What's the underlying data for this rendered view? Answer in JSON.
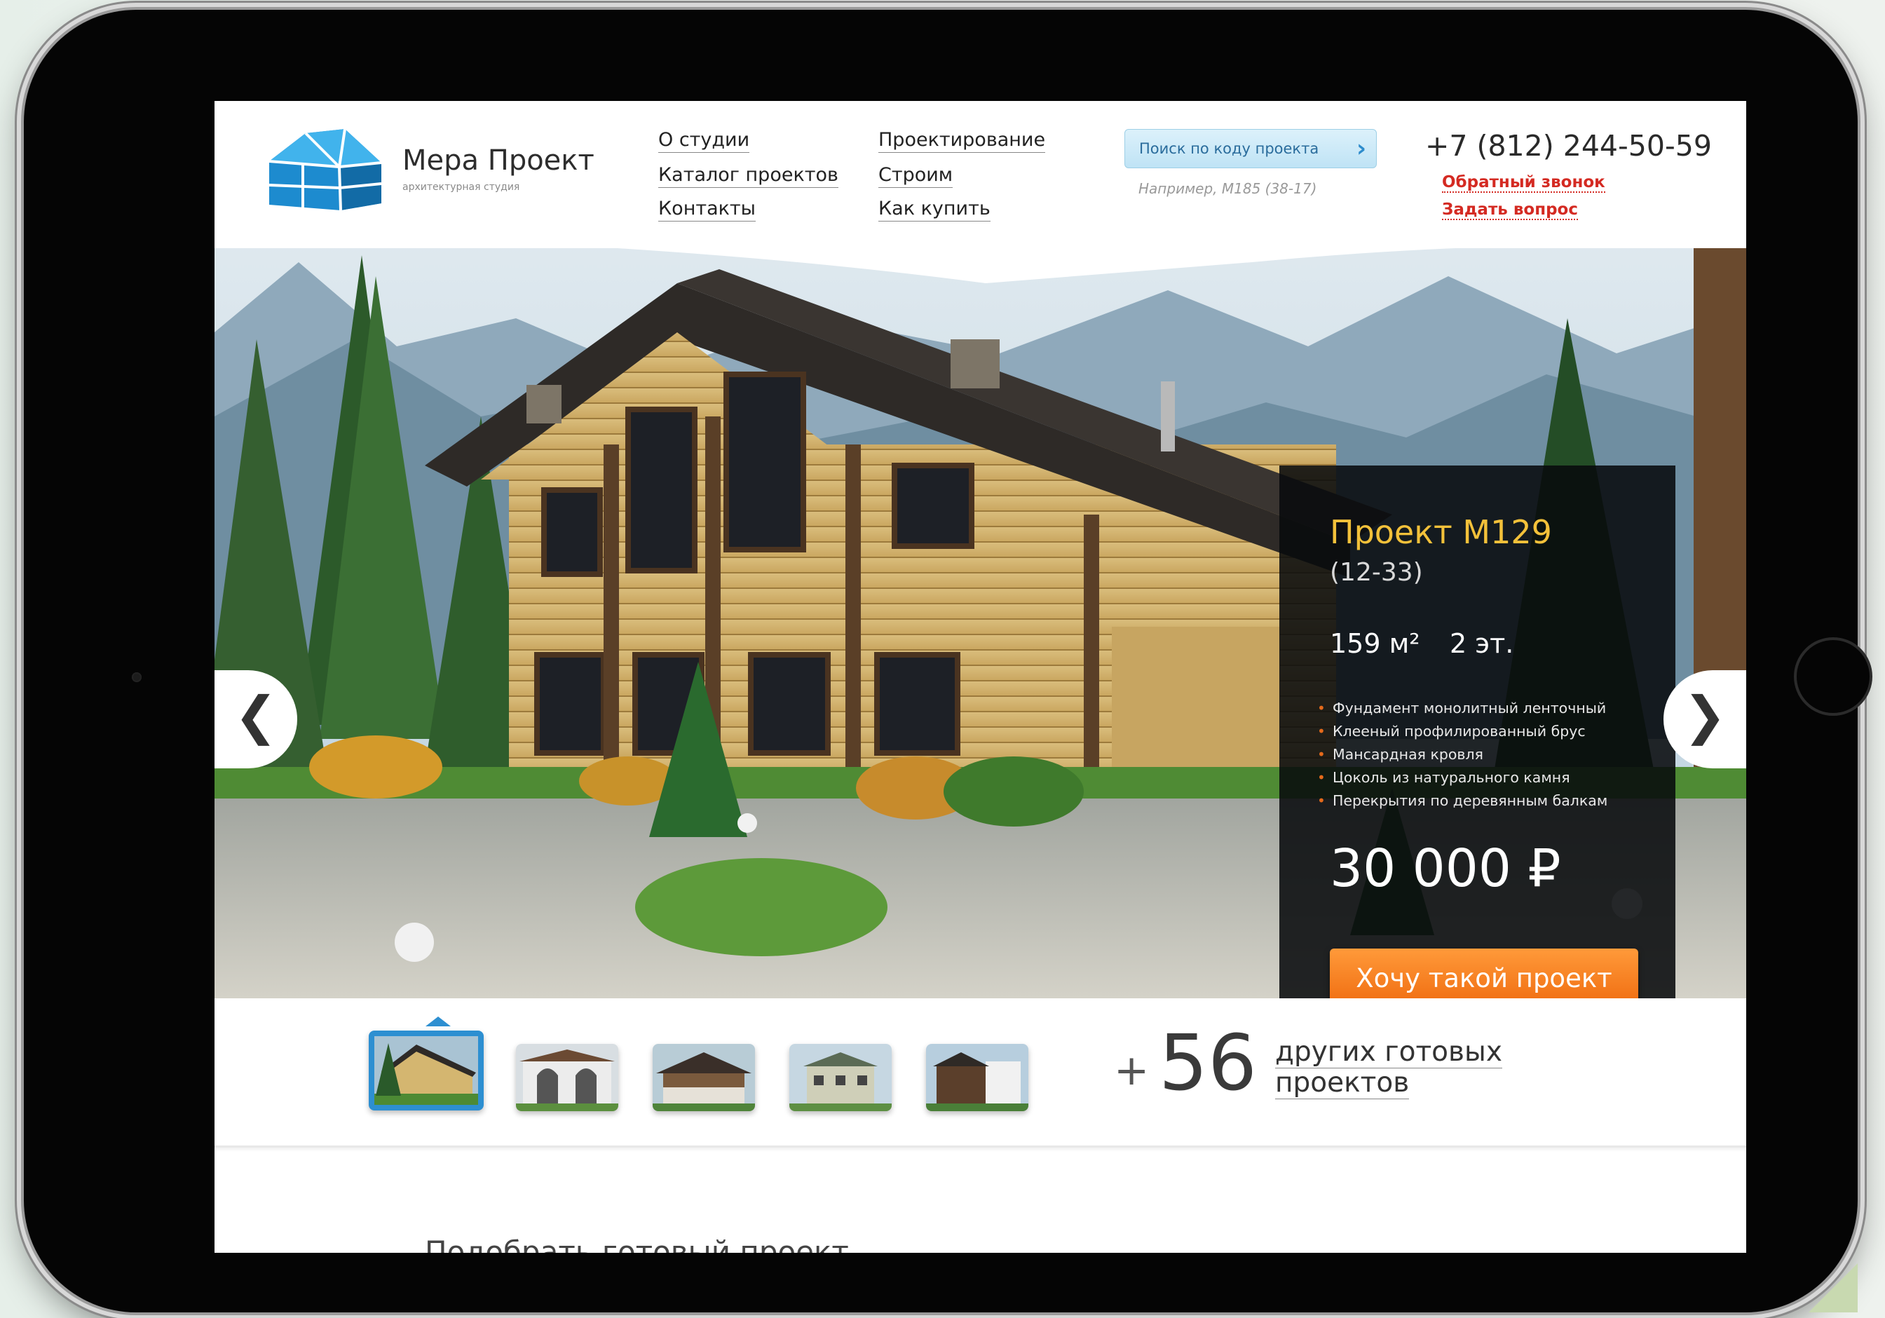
{
  "logo": {
    "title": "Мера Проект",
    "subtitle": "архитектурная студия"
  },
  "nav": {
    "col1": [
      "О студии",
      "Каталог проектов",
      "Контакты"
    ],
    "col2": [
      "Проектирование",
      "Строим",
      "Как купить"
    ]
  },
  "search": {
    "button_label": "Поиск по коду проекта",
    "hint": "Например, М185 (38-17)"
  },
  "contact": {
    "phone": "+7 (812) 244-50-59",
    "callback": "Обратный звонок",
    "ask": "Задать вопрос"
  },
  "project": {
    "title": "Проект М129",
    "code": "(12-33)",
    "area": "159 м²",
    "floors": "2 эт.",
    "features": [
      "Фундамент монолитный ленточный",
      "Клееный профилированный брус",
      "Мансардная кровля",
      "Цоколь из натурального камня",
      "Перекрытия по деревянным балкам"
    ],
    "price": "30 000 ₽",
    "cta": "Хочу такой проект"
  },
  "slider": {
    "prev": "❮",
    "next": "❯",
    "active_index": 0,
    "thumb_count": 5
  },
  "more": {
    "plus": "+",
    "count": "56",
    "label": "других готовых проектов"
  },
  "next_section_heading": "Подобрать готовый проект",
  "colors": {
    "accent_orange": "#ef6a0e",
    "title_yellow": "#f3c13a",
    "link_red": "#d42a22",
    "thumb_border": "#2d8fd1"
  }
}
